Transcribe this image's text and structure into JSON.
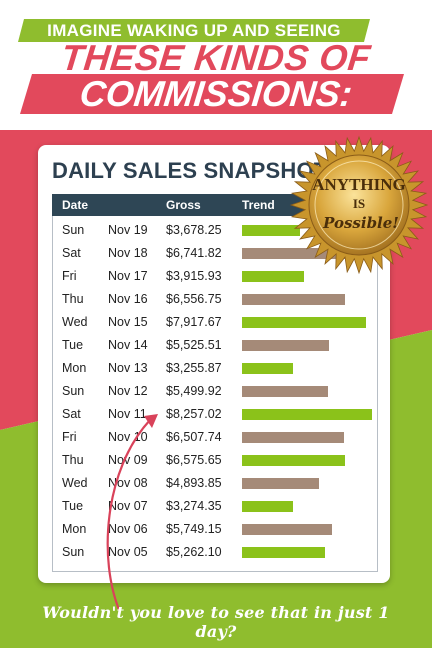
{
  "header": {
    "line1": "IMAGINE WAKING UP AND SEEING",
    "line2": "THESE KINDS OF",
    "line3": "COMMISSIONS:"
  },
  "card": {
    "title": "DAILY SALES SNAPSHOT",
    "columns": [
      "Date",
      "Gross",
      "Trend"
    ]
  },
  "seal": {
    "line1": "ANYTHING",
    "line2": "IS",
    "line3": "Possible!"
  },
  "tagline": "Wouldn't you love to see that in just 1 day?",
  "colors": {
    "pink": "#e2495c",
    "green": "#8fbd2e",
    "bar_green": "#8bc21a",
    "bar_brown": "#a58a78",
    "table_header": "#2e4655",
    "gold": "#c8952c"
  },
  "chart_data": {
    "type": "table",
    "columns": [
      "Date",
      "Gross",
      "Trend"
    ],
    "rows": [
      {
        "day": "Sun",
        "date": "Nov 19",
        "gross": "$3,678.25",
        "value": 3678.25,
        "trend": "up"
      },
      {
        "day": "Sat",
        "date": "Nov 18",
        "gross": "$6,741.82",
        "value": 6741.82,
        "trend": "down"
      },
      {
        "day": "Fri",
        "date": "Nov 17",
        "gross": "$3,915.93",
        "value": 3915.93,
        "trend": "up"
      },
      {
        "day": "Thu",
        "date": "Nov 16",
        "gross": "$6,556.75",
        "value": 6556.75,
        "trend": "down"
      },
      {
        "day": "Wed",
        "date": "Nov 15",
        "gross": "$7,917.67",
        "value": 7917.67,
        "trend": "up"
      },
      {
        "day": "Tue",
        "date": "Nov 14",
        "gross": "$5,525.51",
        "value": 5525.51,
        "trend": "down"
      },
      {
        "day": "Mon",
        "date": "Nov 13",
        "gross": "$3,255.87",
        "value": 3255.87,
        "trend": "up"
      },
      {
        "day": "Sun",
        "date": "Nov 12",
        "gross": "$5,499.92",
        "value": 5499.92,
        "trend": "down"
      },
      {
        "day": "Sat",
        "date": "Nov 11",
        "gross": "$8,257.02",
        "value": 8257.02,
        "trend": "up"
      },
      {
        "day": "Fri",
        "date": "Nov 10",
        "gross": "$6,507.74",
        "value": 6507.74,
        "trend": "down"
      },
      {
        "day": "Thu",
        "date": "Nov 09",
        "gross": "$6,575.65",
        "value": 6575.65,
        "trend": "up"
      },
      {
        "day": "Wed",
        "date": "Nov 08",
        "gross": "$4,893.85",
        "value": 4893.85,
        "trend": "down"
      },
      {
        "day": "Tue",
        "date": "Nov 07",
        "gross": "$3,274.35",
        "value": 3274.35,
        "trend": "up"
      },
      {
        "day": "Mon",
        "date": "Nov 06",
        "gross": "$5,749.15",
        "value": 5749.15,
        "trend": "down"
      },
      {
        "day": "Sun",
        "date": "Nov 05",
        "gross": "$5,262.10",
        "value": 5262.1,
        "trend": "up"
      }
    ]
  }
}
